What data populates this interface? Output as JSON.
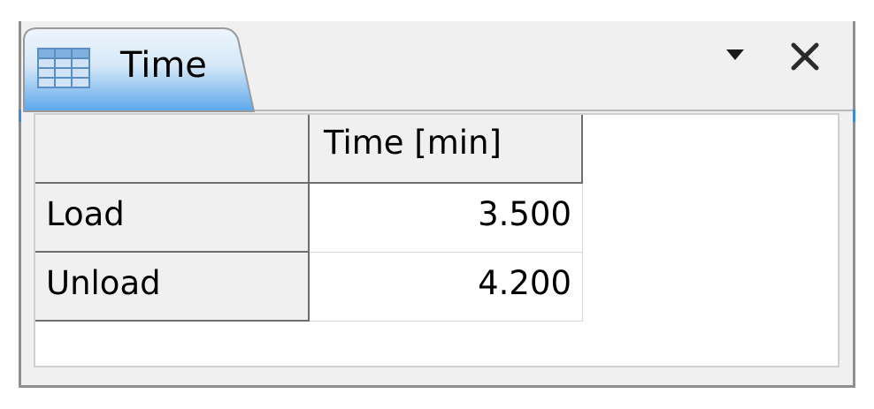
{
  "view": {
    "tab_title": "Time",
    "tab_icon": "table-icon",
    "menu_icon": "view-menu-chevron-icon",
    "close_icon": "close-icon"
  },
  "table": {
    "column_header": "Time [min]",
    "corner": "",
    "rows": [
      {
        "label": "Load",
        "value": "3.500"
      },
      {
        "label": "Unload",
        "value": "4.200"
      }
    ]
  },
  "colors": {
    "tab_gradient_top": "#e6f1fb",
    "tab_gradient_bottom": "#5aa7ea",
    "grid_line": "#6e6e6e",
    "header_bg": "#f0f0f0"
  }
}
